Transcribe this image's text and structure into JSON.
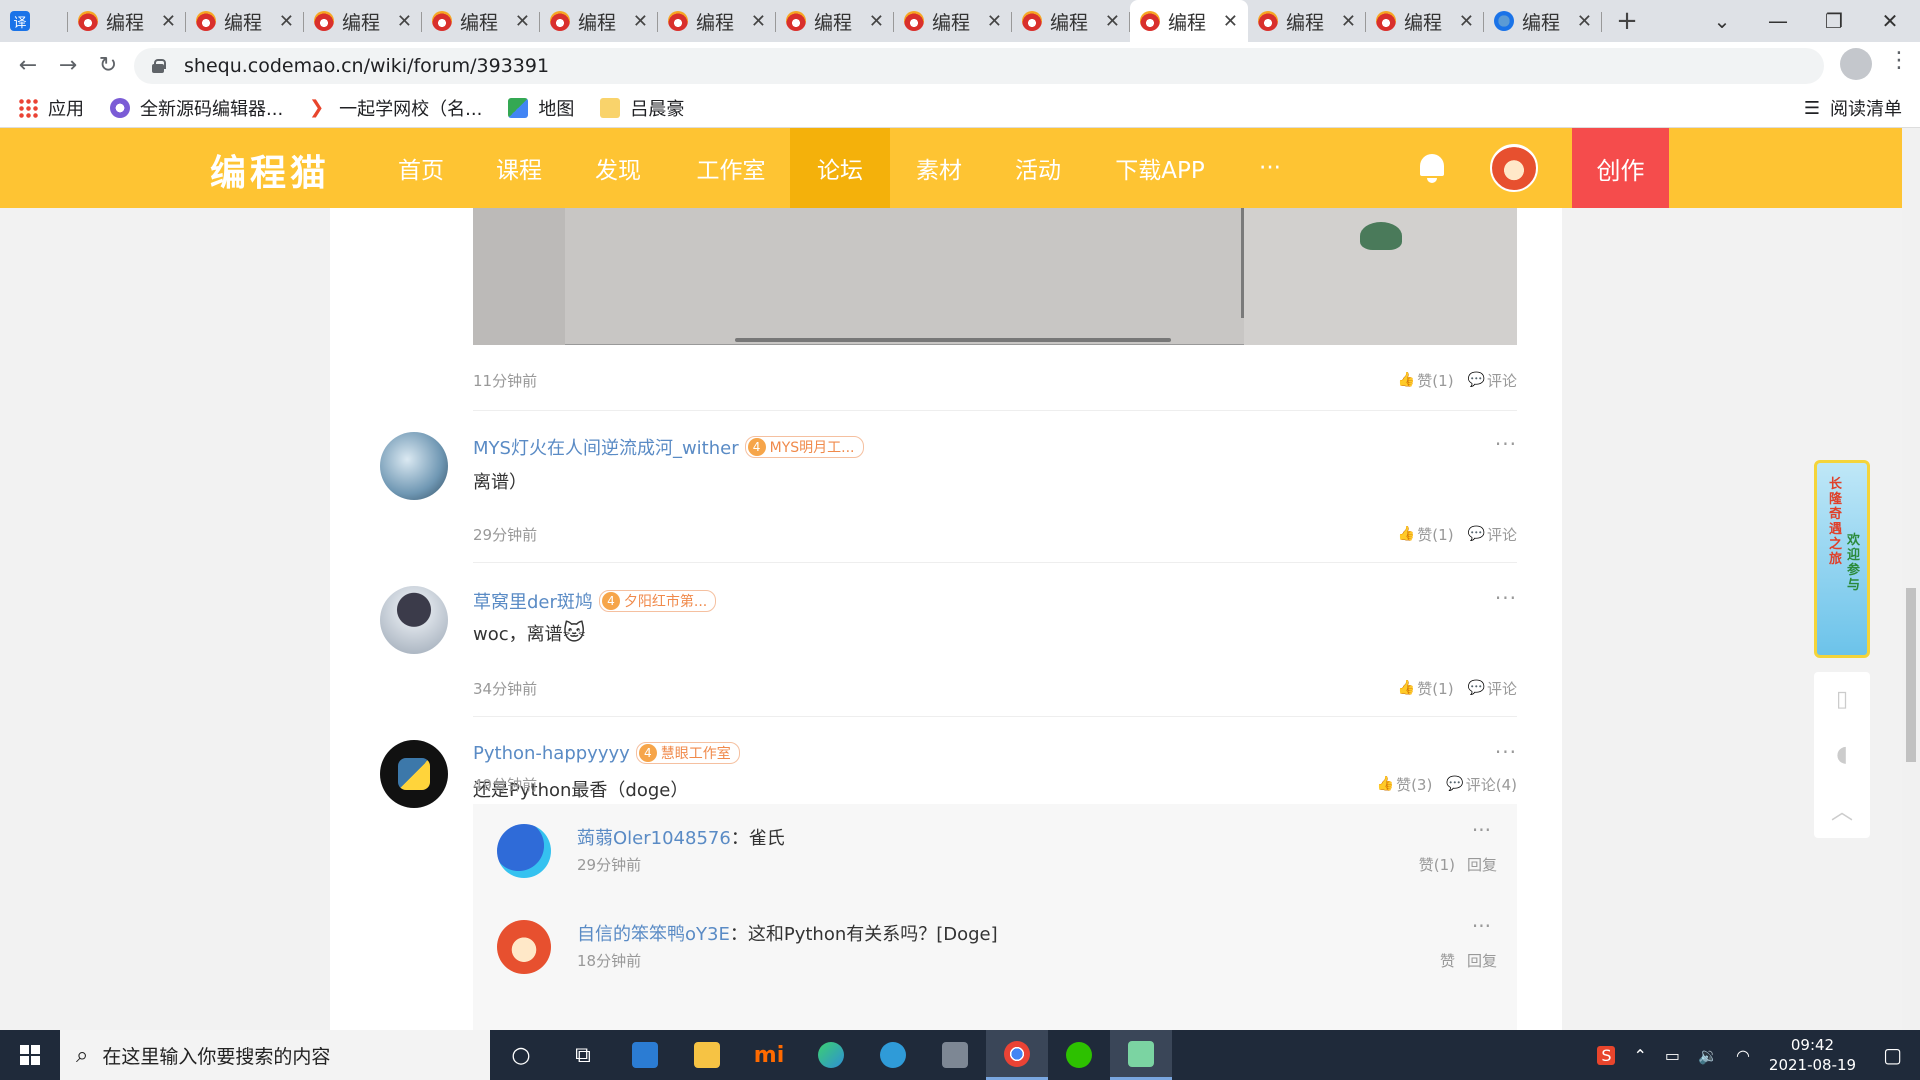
{
  "browser": {
    "tabs": [
      {
        "label": "",
        "icon": "translate-icon",
        "kind": "translate",
        "glyph": "译"
      },
      {
        "label": "编程",
        "icon": "codemao-icon",
        "kind": "codemao"
      },
      {
        "label": "编程",
        "icon": "codemao-icon",
        "kind": "codemao"
      },
      {
        "label": "编程",
        "icon": "codemao-icon",
        "kind": "codemao"
      },
      {
        "label": "编程",
        "icon": "codemao-icon",
        "kind": "codemao"
      },
      {
        "label": "编程",
        "icon": "codemao-icon",
        "kind": "codemao"
      },
      {
        "label": "编程",
        "icon": "codemao-icon",
        "kind": "codemao"
      },
      {
        "label": "编程",
        "icon": "codemao-icon",
        "kind": "codemao"
      },
      {
        "label": "编程",
        "icon": "codemao-icon",
        "kind": "codemao"
      },
      {
        "label": "编程",
        "icon": "codemao-icon",
        "kind": "codemao"
      },
      {
        "label": "编程",
        "icon": "codemao-icon",
        "kind": "codemao",
        "active": true
      },
      {
        "label": "编程",
        "icon": "codemao-icon",
        "kind": "codemao"
      },
      {
        "label": "编程",
        "icon": "codemao-icon",
        "kind": "codemao"
      },
      {
        "label": "编程",
        "icon": "blue-logo-icon",
        "kind": "blue"
      }
    ],
    "url": "shequ.codemao.cn/wiki/forum/393391",
    "bookmarks": [
      {
        "label": "应用",
        "icon": "apps-grid-icon"
      },
      {
        "label": "全新源码编辑器...",
        "icon": "editor-icon"
      },
      {
        "label": "一起学网校（名...",
        "icon": "play-arrow-icon"
      },
      {
        "label": "地图",
        "icon": "map-icon"
      },
      {
        "label": "吕晨豪",
        "icon": "folder-icon"
      }
    ],
    "reading_list": "阅读清单"
  },
  "site": {
    "logo": "编程猫",
    "nav": [
      "首页",
      "课程",
      "发现",
      "工作室",
      "论坛",
      "素材",
      "活动",
      "下载APP",
      "···"
    ],
    "active_nav": "论坛",
    "create_label": "创作"
  },
  "colors": {
    "header": "#fec433",
    "active_nav": "#f4b10b",
    "create": "#f54c4c",
    "link": "#5a8bc5"
  },
  "top_post": {
    "time": "11分钟前",
    "like": "赞(1)",
    "comment": "评论"
  },
  "comments": [
    {
      "user": "MYS灯火在人间逆流成河_wither",
      "level": "4",
      "badge": "MYS明月工...",
      "text": "离谱）",
      "time": "29分钟前",
      "like": "赞(1)",
      "comment": "评论"
    },
    {
      "user": "草窝里der斑鸠",
      "level": "4",
      "badge": "夕阳红市第...",
      "text": "woc，离谱",
      "emoji": "🐱",
      "time": "34分钟前",
      "like": "赞(1)",
      "comment": "评论"
    },
    {
      "user": "Python-happyyyy",
      "level": "4",
      "badge": "慧眼工作室",
      "text": "还是Python最香（doge）",
      "time": "49分钟前",
      "like": "赞(3)",
      "comment": "评论(4)"
    }
  ],
  "replies": [
    {
      "user": "蒟蒻Oler1048576",
      "text": "：雀氏",
      "time": "29分钟前",
      "like": "赞(1)",
      "reply": "回复"
    },
    {
      "user": "自信的笨笨鸭oY3E",
      "text": "：这和Python有关系吗？[Doge]",
      "time": "18分钟前",
      "like": "赞",
      "reply": "回复"
    }
  ],
  "side_banner": {
    "text_a": "长隆奇遇之旅",
    "text_b": "欢迎参与"
  },
  "taskbar": {
    "search_placeholder": "在这里输入你要搜索的内容",
    "time": "09:42",
    "date": "2021-08-19"
  }
}
